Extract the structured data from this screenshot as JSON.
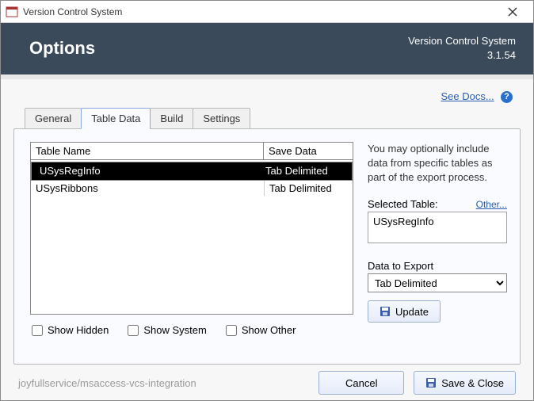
{
  "window": {
    "title": "Version Control System"
  },
  "header": {
    "title": "Options",
    "product": "Version Control System",
    "version": "3.1.54"
  },
  "docs": {
    "label": "See Docs...",
    "help_glyph": "?"
  },
  "tabs": {
    "general": "General",
    "table_data": "Table Data",
    "build": "Build",
    "settings": "Settings"
  },
  "grid": {
    "columns": {
      "name": "Table Name",
      "save": "Save Data"
    },
    "rows": [
      {
        "name": "USysRegInfo",
        "save": "Tab Delimited",
        "selected": true
      },
      {
        "name": "USysRibbons",
        "save": "Tab Delimited",
        "selected": false
      }
    ]
  },
  "checks": {
    "hidden": "Show Hidden",
    "system": "Show System",
    "other": "Show Other"
  },
  "side": {
    "info": "You may optionally include data from specific tables as part of the export process.",
    "selected_label": "Selected Table:",
    "other_link": "Other...",
    "selected_value": "USysRegInfo",
    "export_label": "Data to Export",
    "export_value": "Tab Delimited",
    "update_btn": "Update"
  },
  "footer": {
    "repo": "joyfullservice/msaccess-vcs-integration",
    "cancel": "Cancel",
    "save_close": "Save & Close"
  }
}
